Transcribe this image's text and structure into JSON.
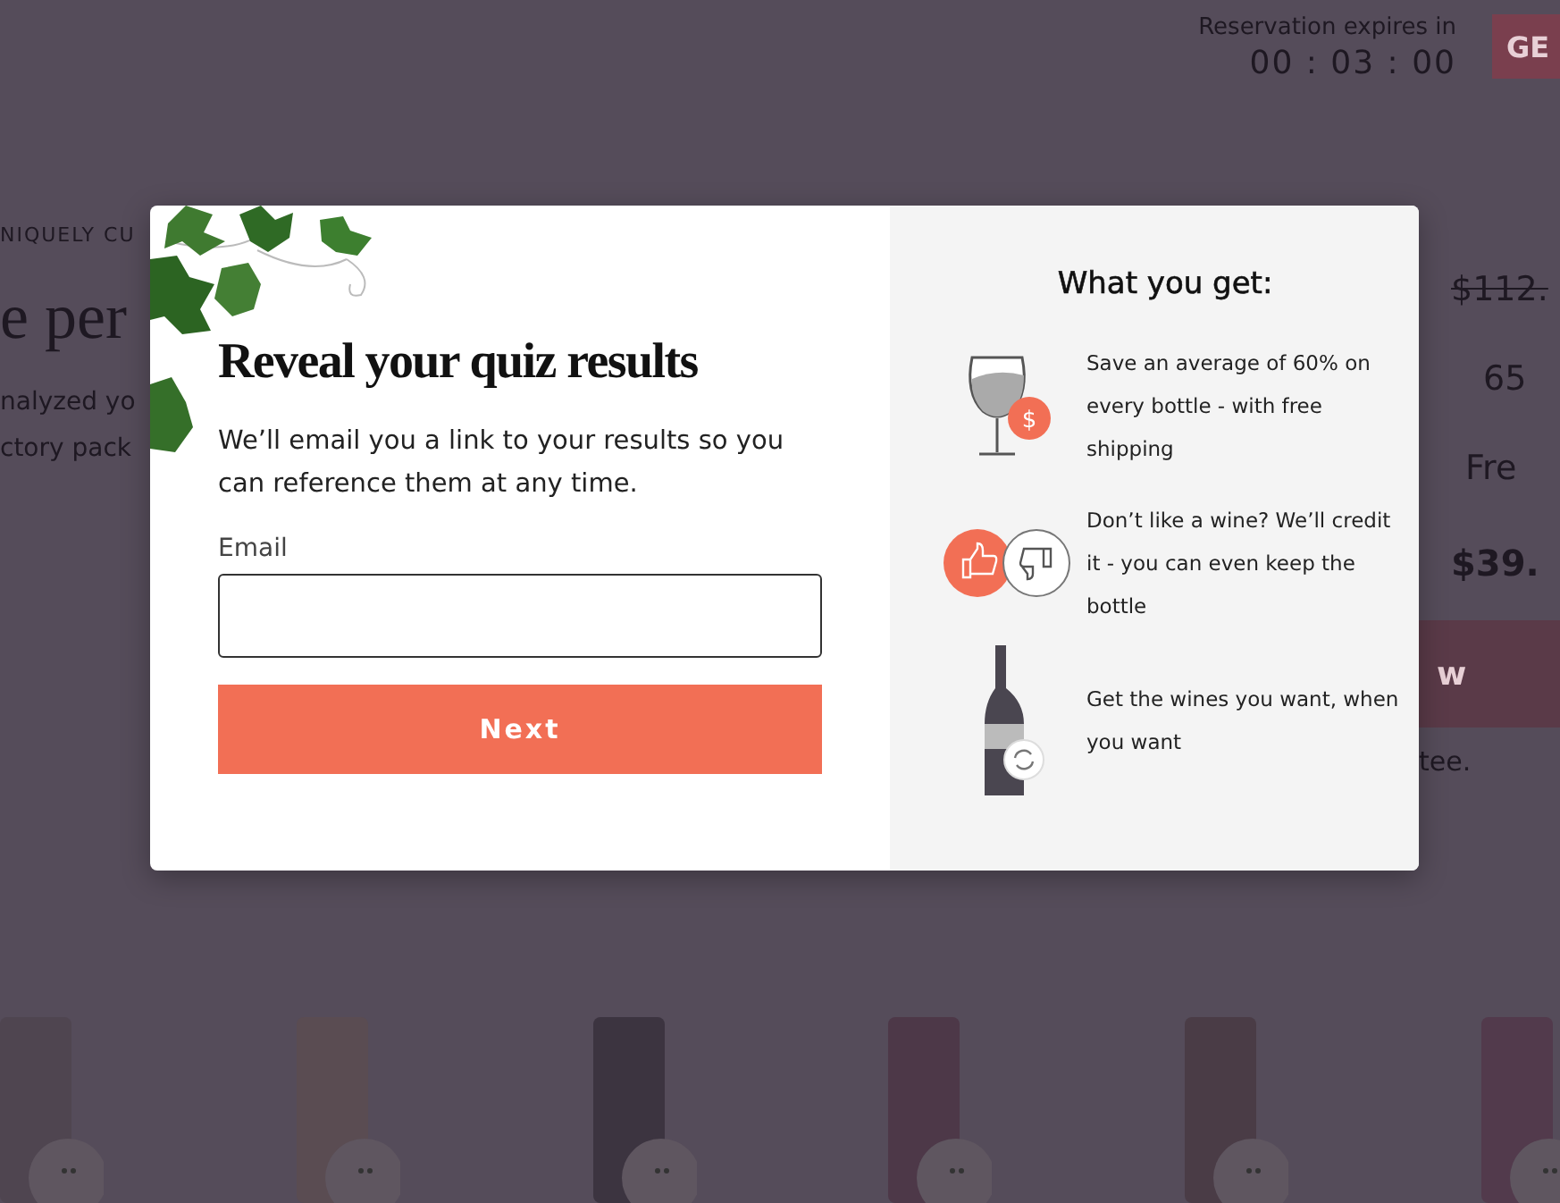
{
  "header": {
    "reservation_label": "Reservation expires in",
    "timer": "00 : 03 : 00",
    "button": "GE"
  },
  "background_left": {
    "eyebrow": "NIQUELY CU",
    "heading": "e per",
    "lines": [
      "nalyzed yo",
      "ctory pack"
    ]
  },
  "background_right": {
    "original_price": "$112.",
    "rows": [
      "65",
      "Fre"
    ],
    "total": "$39.",
    "button": "w",
    "note": "tee."
  },
  "modal": {
    "title": "Reveal your quiz results",
    "description": "We’ll email you a link to your results so you can reference them at any time.",
    "email_label": "Email",
    "button": "Next",
    "benefits_title": "What you get:",
    "benefits": [
      {
        "kind": "savings",
        "badge": "$",
        "text": "Save an average of 60% on every bottle - with free shipping"
      },
      {
        "kind": "credit",
        "text": "Don’t like a wine? We’ll credit it - you can even keep the bottle"
      },
      {
        "kind": "choice",
        "text": "Get the wines you want, when you want"
      }
    ]
  }
}
